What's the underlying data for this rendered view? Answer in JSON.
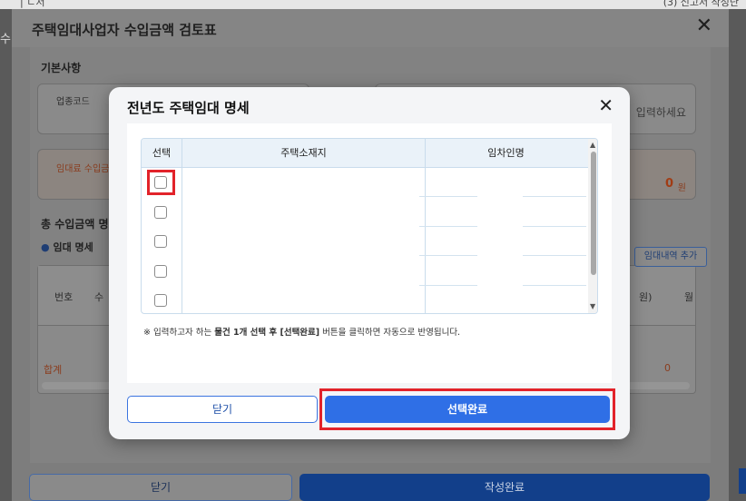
{
  "background": {
    "top_left_fragment": "| ㄴ서",
    "top_right_fragment": "(3) 신고서 작성단",
    "left_edge_fragment": "수"
  },
  "outer_dialog": {
    "title": "주택임대사업자 수입금액 검토표",
    "basic_section": "기본사항",
    "industry_code_label": "업종코드",
    "input_placeholder_fragment": "입력하세요",
    "rent_income_label": "임대료 수입금",
    "rent_income_value": "0",
    "rent_income_unit": "원",
    "total_income_section": "총 수입금액 명",
    "rent_detail_label": "임대 명세",
    "add_detail_button": "임대내역 추가",
    "col_no": "번호",
    "col_frag": "수",
    "col_right_frag": "원)",
    "col_right_frag2": "월",
    "total_label": "합계",
    "total_value": "0",
    "close_button": "닫기",
    "complete_button": "작성완료"
  },
  "modal": {
    "title": "전년도 주택임대 명세",
    "table": {
      "headers": [
        "선택",
        "주택소재지",
        "임차인명"
      ],
      "rows": 5
    },
    "note_prefix": "※ 입력하고자 하는 ",
    "note_bold": "물건 1개 선택 후 [선택완료]",
    "note_suffix": " 버튼을 클릭하면 자동으로 반영됩니다.",
    "close_button": "닫기",
    "done_button": "선택완료"
  },
  "colors": {
    "primary": "#2f6fe6",
    "highlight": "#e2232a",
    "table_header_bg": "#eaf2f9"
  }
}
